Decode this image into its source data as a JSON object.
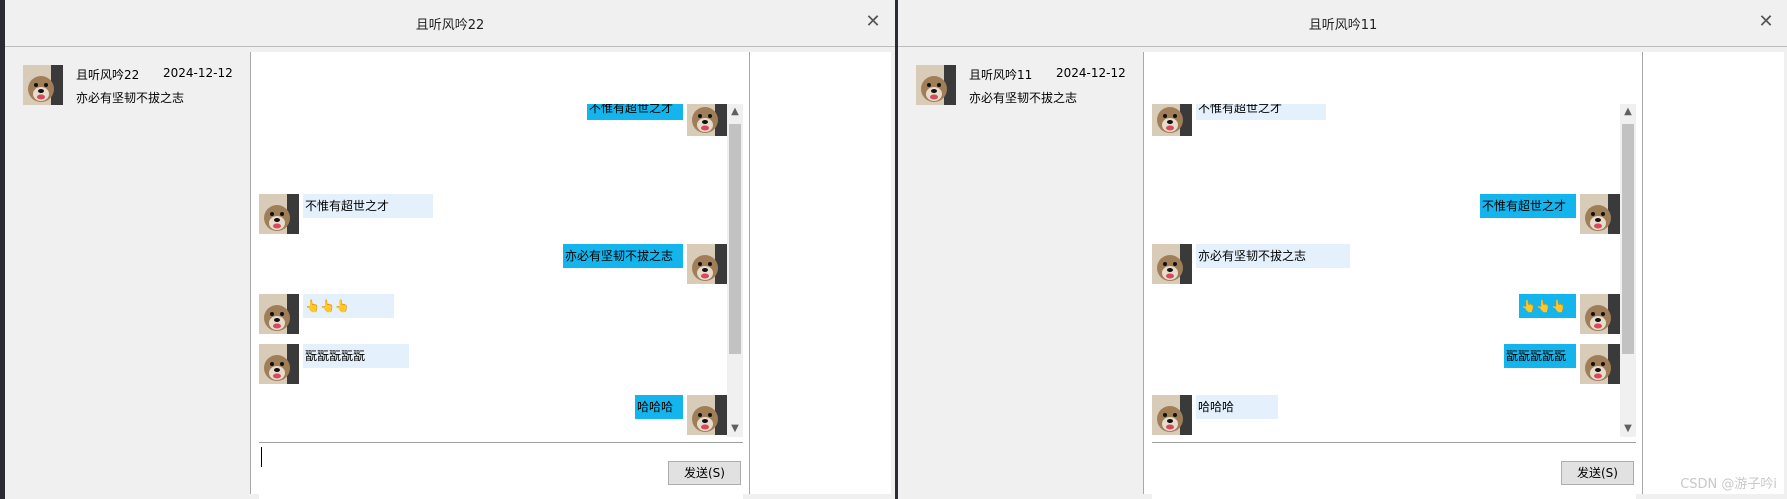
{
  "windows": [
    {
      "title": "且听风吟22",
      "contact": {
        "name": "且听风吟22",
        "date": "2024-12-12",
        "last_message": "亦必有坚韧不拔之志"
      },
      "messages": [
        {
          "side": "right",
          "text": "不惟有超世之才"
        },
        {
          "side": "left",
          "text": "不惟有超世之才"
        },
        {
          "side": "right",
          "text": "亦必有坚韧不拔之志"
        },
        {
          "side": "left",
          "text": "👆👆👆"
        },
        {
          "side": "left",
          "text": "翫翫翫翫翫"
        },
        {
          "side": "right",
          "text": "哈哈哈"
        }
      ],
      "send_label": "发送(S)",
      "scroll_position": 0.06
    },
    {
      "title": "且听风吟11",
      "contact": {
        "name": "且听风吟11",
        "date": "2024-12-12",
        "last_message": "亦必有坚韧不拔之志"
      },
      "messages": [
        {
          "side": "left",
          "text": "不惟有超世之才"
        },
        {
          "side": "right",
          "text": "不惟有超世之才"
        },
        {
          "side": "left",
          "text": "亦必有坚韧不拔之志"
        },
        {
          "side": "right",
          "text": "👆👆👆"
        },
        {
          "side": "right",
          "text": "翫翫翫翫翫"
        },
        {
          "side": "left",
          "text": "哈哈哈"
        }
      ],
      "send_label": "发送(S)",
      "scroll_position": 0.06
    }
  ],
  "watermark": "CSDN @游子吟i",
  "icons": {
    "close": "close-icon",
    "avatar": "dog-avatar-icon",
    "scroll_up": "chevron-up-icon",
    "scroll_down": "chevron-down-icon"
  },
  "colors": {
    "outgoing_bubble": "#14b4ec",
    "incoming_bubble": "#e4f0fb",
    "window_bg": "#f0f0f0"
  }
}
